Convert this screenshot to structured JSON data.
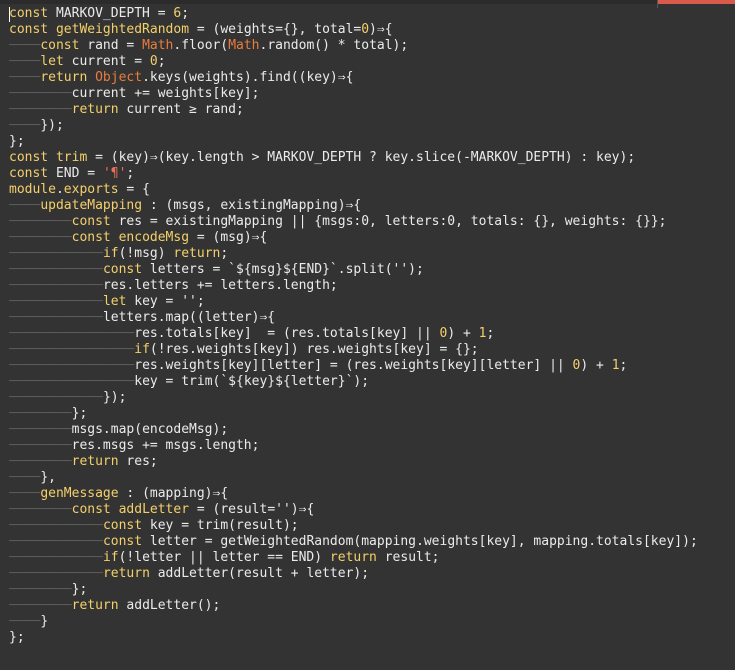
{
  "editor": {
    "colors": {
      "background": "#333333",
      "text": "#ebebeb",
      "keyword": "#f4d06b",
      "builtin": "#e87d3e",
      "indent_guide": "#5a5a5a",
      "tab_accent": "#d85a4a"
    },
    "lines": [
      {
        "indent": 0,
        "segments": [
          [
            "keyword",
            "const"
          ],
          [
            "plain",
            " MARKOV_DEPTH = "
          ],
          [
            "number",
            "6"
          ],
          [
            "punct",
            ";"
          ]
        ]
      },
      {
        "indent": 0,
        "segments": [
          [
            "keyword",
            "const"
          ],
          [
            "plain",
            " "
          ],
          [
            "fn",
            "getWeightedRandom"
          ],
          [
            "plain",
            " = (weights={}, total="
          ],
          [
            "number",
            "0"
          ],
          [
            "plain",
            ")⇒{"
          ]
        ]
      },
      {
        "indent": 1,
        "segments": [
          [
            "keyword",
            "const"
          ],
          [
            "plain",
            " rand = "
          ],
          [
            "builtin",
            "Math"
          ],
          [
            "plain",
            ".floor("
          ],
          [
            "builtin",
            "Math"
          ],
          [
            "plain",
            ".random() * total);"
          ]
        ]
      },
      {
        "indent": 1,
        "segments": [
          [
            "keyword",
            "let"
          ],
          [
            "plain",
            " current = "
          ],
          [
            "number",
            "0"
          ],
          [
            "plain",
            ";"
          ]
        ]
      },
      {
        "indent": 1,
        "segments": [
          [
            "keyword",
            "return"
          ],
          [
            "plain",
            " "
          ],
          [
            "builtin",
            "Object"
          ],
          [
            "plain",
            ".keys(weights).find((key)⇒{"
          ]
        ]
      },
      {
        "indent": 2,
        "segments": [
          [
            "plain",
            "current += weights[key];"
          ]
        ]
      },
      {
        "indent": 2,
        "segments": [
          [
            "keyword",
            "return"
          ],
          [
            "plain",
            " current ≥ rand;"
          ]
        ]
      },
      {
        "indent": 1,
        "segments": [
          [
            "plain",
            "});"
          ]
        ]
      },
      {
        "indent": 0,
        "segments": [
          [
            "plain",
            "};"
          ]
        ]
      },
      {
        "indent": 0,
        "segments": [
          [
            "keyword",
            "const"
          ],
          [
            "plain",
            " "
          ],
          [
            "fn",
            "trim"
          ],
          [
            "plain",
            " = (key)⇒(key.length > MARKOV_DEPTH ? key.slice(-MARKOV_DEPTH) : key);"
          ]
        ]
      },
      {
        "indent": 0,
        "segments": [
          [
            "keyword",
            "const"
          ],
          [
            "plain",
            " END = "
          ],
          [
            "strred",
            "'¶'"
          ],
          [
            "plain",
            ";"
          ]
        ]
      },
      {
        "indent": 0,
        "segments": [
          [
            "keyword",
            "module"
          ],
          [
            "plain",
            "."
          ],
          [
            "keyword",
            "exports"
          ],
          [
            "plain",
            " = {"
          ]
        ]
      },
      {
        "indent": 1,
        "segments": [
          [
            "prop",
            "updateMapping"
          ],
          [
            "plain",
            " : (msgs, existingMapping)⇒{"
          ]
        ]
      },
      {
        "indent": 2,
        "segments": [
          [
            "keyword",
            "const"
          ],
          [
            "plain",
            " res = existingMapping || {msgs:0, letters:0, totals: {}, weights: {}};"
          ]
        ]
      },
      {
        "indent": 2,
        "segments": [
          [
            "keyword",
            "const"
          ],
          [
            "plain",
            " "
          ],
          [
            "fn",
            "encodeMsg"
          ],
          [
            "plain",
            " = (msg)⇒{"
          ]
        ]
      },
      {
        "indent": 3,
        "segments": [
          [
            "keyword",
            "if"
          ],
          [
            "plain",
            "(!msg) "
          ],
          [
            "keyword",
            "return"
          ],
          [
            "plain",
            ";"
          ]
        ]
      },
      {
        "indent": 3,
        "segments": [
          [
            "keyword",
            "const"
          ],
          [
            "plain",
            " letters = `${msg}${END}`.split('');"
          ]
        ]
      },
      {
        "indent": 3,
        "segments": [
          [
            "plain",
            "res.letters += letters.length;"
          ]
        ]
      },
      {
        "indent": 3,
        "segments": [
          [
            "keyword",
            "let"
          ],
          [
            "plain",
            " key = '';"
          ]
        ]
      },
      {
        "indent": 3,
        "segments": [
          [
            "plain",
            "letters.map((letter)⇒{"
          ]
        ]
      },
      {
        "indent": 4,
        "segments": [
          [
            "plain",
            "res.totals[key]  = (res.totals[key] || "
          ],
          [
            "number",
            "0"
          ],
          [
            "plain",
            ") + "
          ],
          [
            "number",
            "1"
          ],
          [
            "plain",
            ";"
          ]
        ]
      },
      {
        "indent": 4,
        "segments": [
          [
            "keyword",
            "if"
          ],
          [
            "plain",
            "(!res.weights[key]) res.weights[key] = {};"
          ]
        ]
      },
      {
        "indent": 4,
        "segments": [
          [
            "plain",
            "res.weights[key][letter] = (res.weights[key][letter] || "
          ],
          [
            "number",
            "0"
          ],
          [
            "plain",
            ") + "
          ],
          [
            "number",
            "1"
          ],
          [
            "plain",
            ";"
          ]
        ]
      },
      {
        "indent": 4,
        "segments": [
          [
            "plain",
            "key = trim(`${key}${letter}`);"
          ]
        ]
      },
      {
        "indent": 3,
        "segments": [
          [
            "plain",
            "});"
          ]
        ]
      },
      {
        "indent": 2,
        "segments": [
          [
            "plain",
            "};"
          ]
        ]
      },
      {
        "indent": 2,
        "segments": [
          [
            "plain",
            "msgs.map(encodeMsg);"
          ]
        ]
      },
      {
        "indent": 2,
        "segments": [
          [
            "plain",
            "res.msgs += msgs.length;"
          ]
        ]
      },
      {
        "indent": 2,
        "segments": [
          [
            "keyword",
            "return"
          ],
          [
            "plain",
            " res;"
          ]
        ]
      },
      {
        "indent": 1,
        "segments": [
          [
            "plain",
            "},"
          ]
        ]
      },
      {
        "indent": 1,
        "segments": [
          [
            "prop",
            "genMessage"
          ],
          [
            "plain",
            " : (mapping)⇒{"
          ]
        ]
      },
      {
        "indent": 2,
        "segments": [
          [
            "keyword",
            "const"
          ],
          [
            "plain",
            " "
          ],
          [
            "fn",
            "addLetter"
          ],
          [
            "plain",
            " = (result='')⇒{"
          ]
        ]
      },
      {
        "indent": 3,
        "segments": [
          [
            "keyword",
            "const"
          ],
          [
            "plain",
            " key = trim(result);"
          ]
        ]
      },
      {
        "indent": 3,
        "segments": [
          [
            "keyword",
            "const"
          ],
          [
            "plain",
            " letter = getWeightedRandom(mapping.weights[key], mapping.totals[key]);"
          ]
        ]
      },
      {
        "indent": 3,
        "segments": [
          [
            "keyword",
            "if"
          ],
          [
            "plain",
            "(!letter || letter == END) "
          ],
          [
            "keyword",
            "return"
          ],
          [
            "plain",
            " result;"
          ]
        ]
      },
      {
        "indent": 3,
        "segments": [
          [
            "keyword",
            "return"
          ],
          [
            "plain",
            " addLetter(result + letter);"
          ]
        ]
      },
      {
        "indent": 2,
        "segments": [
          [
            "plain",
            "};"
          ]
        ]
      },
      {
        "indent": 2,
        "segments": [
          [
            "keyword",
            "return"
          ],
          [
            "plain",
            " addLetter();"
          ]
        ]
      },
      {
        "indent": 1,
        "segments": [
          [
            "plain",
            "}"
          ]
        ]
      },
      {
        "indent": 0,
        "segments": [
          [
            "plain",
            "};"
          ]
        ]
      }
    ]
  }
}
